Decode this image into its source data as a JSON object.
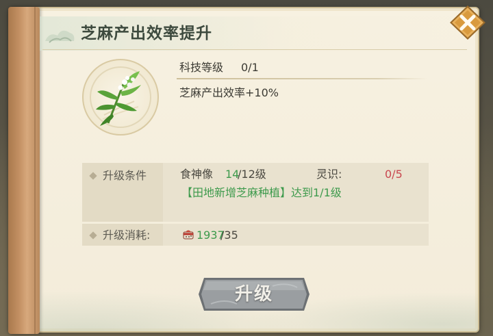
{
  "dialog": {
    "title": "芝麻产出效率提升",
    "close_icon": "close-icon"
  },
  "tech": {
    "level_label": "科技等级",
    "level_value": "0/1",
    "effect": "芝麻产出效率+10%",
    "item_icon": "sesame-plant-icon"
  },
  "conditions": {
    "header": "升级条件",
    "req1_label": "食神像",
    "req1_current": "14",
    "req1_required": "/12级",
    "req2_label": "灵识:",
    "req2_value": "0/5",
    "req3_text": "【田地新增芝麻种植】达到1/1级"
  },
  "cost": {
    "header": "升级消耗:",
    "resource_icon": "sesame-resource-icon",
    "current": "1937",
    "required": "/35"
  },
  "actions": {
    "upgrade_label": "升级"
  },
  "colors": {
    "accent_green": "#3d9a4c",
    "warning_red": "#c9474f",
    "close_button": "#e2a84f",
    "upgrade_button": "#8d9194"
  }
}
